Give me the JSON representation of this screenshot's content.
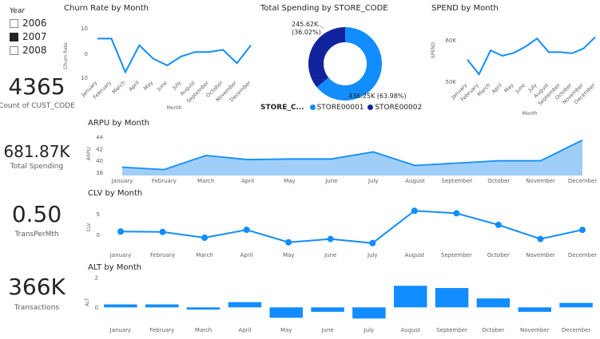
{
  "slicer": {
    "title": "Year",
    "items": [
      {
        "label": "2006",
        "checked": false
      },
      {
        "label": "2007",
        "checked": true
      },
      {
        "label": "2008",
        "checked": false
      }
    ]
  },
  "kpis": [
    {
      "value": "4365",
      "label": "Count of CUST_CODE"
    },
    {
      "value": "681.87K",
      "label": "Total Spending"
    },
    {
      "value": "0.50",
      "label": "TransPerMth"
    },
    {
      "value": "366K",
      "label": "Transactions"
    }
  ],
  "months": [
    "January",
    "February",
    "March",
    "April",
    "May",
    "June",
    "July",
    "August",
    "September",
    "October",
    "November",
    "December"
  ],
  "chart_data": [
    {
      "id": "churn",
      "type": "line",
      "title": "Churn Rate by Month",
      "xlabel": "Month",
      "ylabel": "Churn Rate",
      "yticks": [
        "10",
        "0",
        "10"
      ],
      "ylim": [
        -10,
        10
      ],
      "categories": [
        "January",
        "February",
        "March",
        "April",
        "May",
        "June",
        "July",
        "August",
        "September",
        "October",
        "November",
        "December"
      ],
      "values": [
        7,
        7,
        -8,
        4,
        -2,
        -5,
        -1,
        1,
        1,
        2,
        -4,
        4
      ],
      "color": "#118DFF"
    },
    {
      "id": "spending",
      "type": "pie",
      "title": "Total Spending by STORE_CODE",
      "legend_title": "STORE_C...",
      "slices": [
        {
          "name": "STORE00001",
          "value": 436.25,
          "label": "436.25K (63.98%)",
          "color": "#118DFF"
        },
        {
          "name": "STORE00002",
          "value": 245.62,
          "label": "245.62K (36.02%)",
          "color": "#12239E"
        }
      ]
    },
    {
      "id": "spend",
      "type": "line",
      "title": "SPEND by Month",
      "xlabel": "Month",
      "ylabel": "SPEND",
      "yticks": [
        "60K",
        "50K"
      ],
      "ylim": [
        49000,
        62000
      ],
      "categories": [
        "January",
        "February",
        "March",
        "April",
        "May",
        "June",
        "July",
        "August",
        "September",
        "October",
        "November",
        "December"
      ],
      "values": [
        54500,
        50500,
        57000,
        55500,
        56300,
        58000,
        60200,
        56500,
        56500,
        56200,
        57500,
        60600
      ],
      "color": "#118DFF"
    },
    {
      "id": "arpu",
      "type": "area",
      "title": "ARPU by Month",
      "ylabel": "ARPU",
      "yticks": [
        "44",
        "42",
        "40",
        "38"
      ],
      "ylim": [
        37.5,
        44
      ],
      "categories": [
        "January",
        "February",
        "March",
        "April",
        "May",
        "June",
        "July",
        "August",
        "September",
        "October",
        "November",
        "December"
      ],
      "values": [
        38.9,
        38.5,
        40.9,
        40.2,
        40.3,
        40.3,
        41.5,
        39.2,
        39.6,
        40.0,
        40.0,
        43.5
      ],
      "color": "#118DFF"
    },
    {
      "id": "clv",
      "type": "line",
      "title": "CLV by Month",
      "ylabel": "CLV",
      "yticks": [
        "5",
        "0"
      ],
      "ylim": [
        -3,
        7
      ],
      "categories": [
        "January",
        "February",
        "March",
        "April",
        "May",
        "June",
        "July",
        "August",
        "September",
        "October",
        "November",
        "December"
      ],
      "values": [
        0.8,
        0.7,
        -0.7,
        1.2,
        -1.8,
        -1.0,
        -2.0,
        5.8,
        5.2,
        2.4,
        -1.0,
        1.2
      ],
      "color": "#118DFF"
    },
    {
      "id": "alt",
      "type": "bar",
      "title": "ALT by Month",
      "ylabel": "ALT",
      "yticks": [
        "2",
        "0"
      ],
      "ylim": [
        -1,
        2
      ],
      "categories": [
        "January",
        "February",
        "March",
        "April",
        "May",
        "June",
        "July",
        "August",
        "September",
        "October",
        "November",
        "December"
      ],
      "values": [
        0.2,
        0.2,
        -0.15,
        0.35,
        -0.7,
        -0.3,
        -0.75,
        1.45,
        1.3,
        0.6,
        -0.3,
        0.3
      ],
      "color": "#118DFF"
    }
  ]
}
